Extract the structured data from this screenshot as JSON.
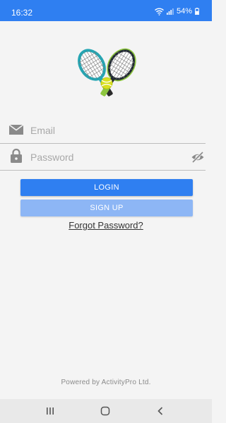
{
  "status_bar": {
    "time": "16:32",
    "battery": "54%",
    "background_color": "#2f7ff1",
    "icons": [
      "wifi-icon",
      "signal-icon",
      "battery-icon"
    ]
  },
  "logo": {
    "icon": "tennis-rackets-logo"
  },
  "form": {
    "email": {
      "placeholder": "Email",
      "value": "",
      "icon": "mail-icon"
    },
    "password": {
      "placeholder": "Password",
      "value": "",
      "icon": "lock-icon",
      "toggle_icon": "eye-off-icon"
    }
  },
  "buttons": {
    "login_label": "LOGIN",
    "signup_label": "SIGN UP",
    "login_color": "#2f7ff1",
    "signup_color": "#8db6f5"
  },
  "forgot_password_label": "Forgot Password?",
  "footer": {
    "powered_by": "Powered by ActivityPro Ltd."
  },
  "nav_bar": {
    "icons": [
      "recents-icon",
      "home-icon",
      "back-icon"
    ]
  }
}
